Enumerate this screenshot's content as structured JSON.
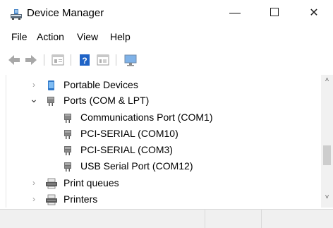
{
  "window": {
    "title": "Device Manager",
    "controls": {
      "minimize": "—",
      "close": "✕"
    }
  },
  "menu": [
    "File",
    "Action",
    "View",
    "Help"
  ],
  "toolbar": [
    "back-icon",
    "forward-icon",
    "properties-icon",
    "help-icon",
    "view-icon",
    "monitor-icon"
  ],
  "tree": [
    {
      "label": "Portable Devices",
      "icon": "portable-device-icon",
      "expander": "›",
      "expanded": false
    },
    {
      "label": "Ports (COM & LPT)",
      "icon": "port-icon",
      "expander": "⌄",
      "expanded": true
    },
    {
      "label": "Communications Port (COM1)",
      "icon": "port-icon"
    },
    {
      "label": "PCI-SERIAL (COM10)",
      "icon": "port-icon"
    },
    {
      "label": "PCI-SERIAL (COM3)",
      "icon": "port-icon"
    },
    {
      "label": "USB Serial Port (COM12)",
      "icon": "port-icon"
    },
    {
      "label": "Print queues",
      "icon": "printer-icon",
      "expander": "›",
      "expanded": false
    },
    {
      "label": "Printers",
      "icon": "printer-icon",
      "expander": "›",
      "expanded": false
    }
  ],
  "scrollbar": {
    "up": "˄",
    "down": "˅"
  }
}
